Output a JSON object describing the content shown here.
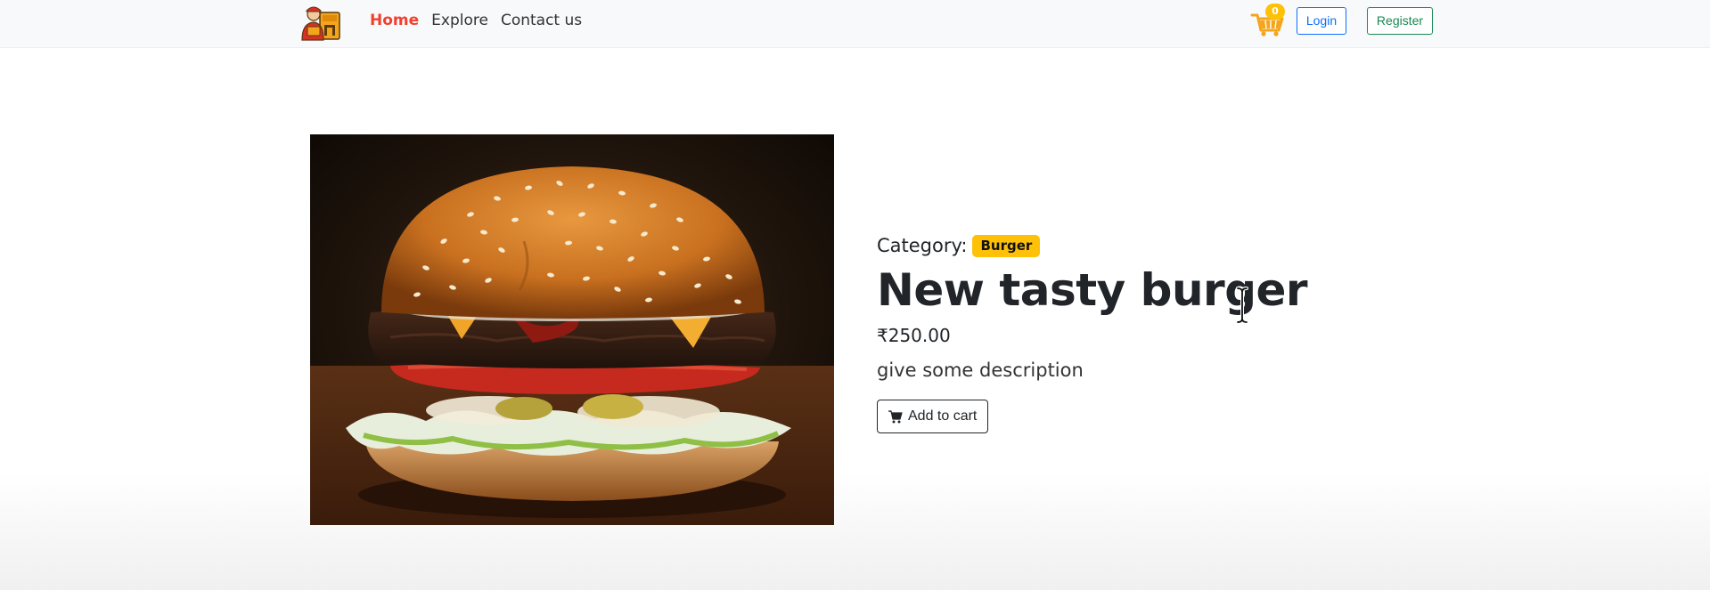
{
  "nav": {
    "logo_icon": "delivery-person-logo-icon",
    "links": [
      {
        "label": "Home",
        "active": true
      },
      {
        "label": "Explore",
        "active": false
      },
      {
        "label": "Contact us",
        "active": false
      }
    ],
    "cart_icon": "shopping-cart-icon",
    "cart_count": "0",
    "login_label": "Login",
    "register_label": "Register"
  },
  "product": {
    "category_label": "Category:",
    "category": "Burger",
    "title": "New tasty burger",
    "price": "₹250.00",
    "description": "give some description",
    "add_to_cart_label": "Add to cart",
    "add_to_cart_icon": "cart-icon"
  },
  "colors": {
    "nav_active": "#f0412f",
    "badge": "#ffc107",
    "login": "#0d6efd",
    "register": "#198754",
    "navbar_bg": "#f8f9fa"
  }
}
